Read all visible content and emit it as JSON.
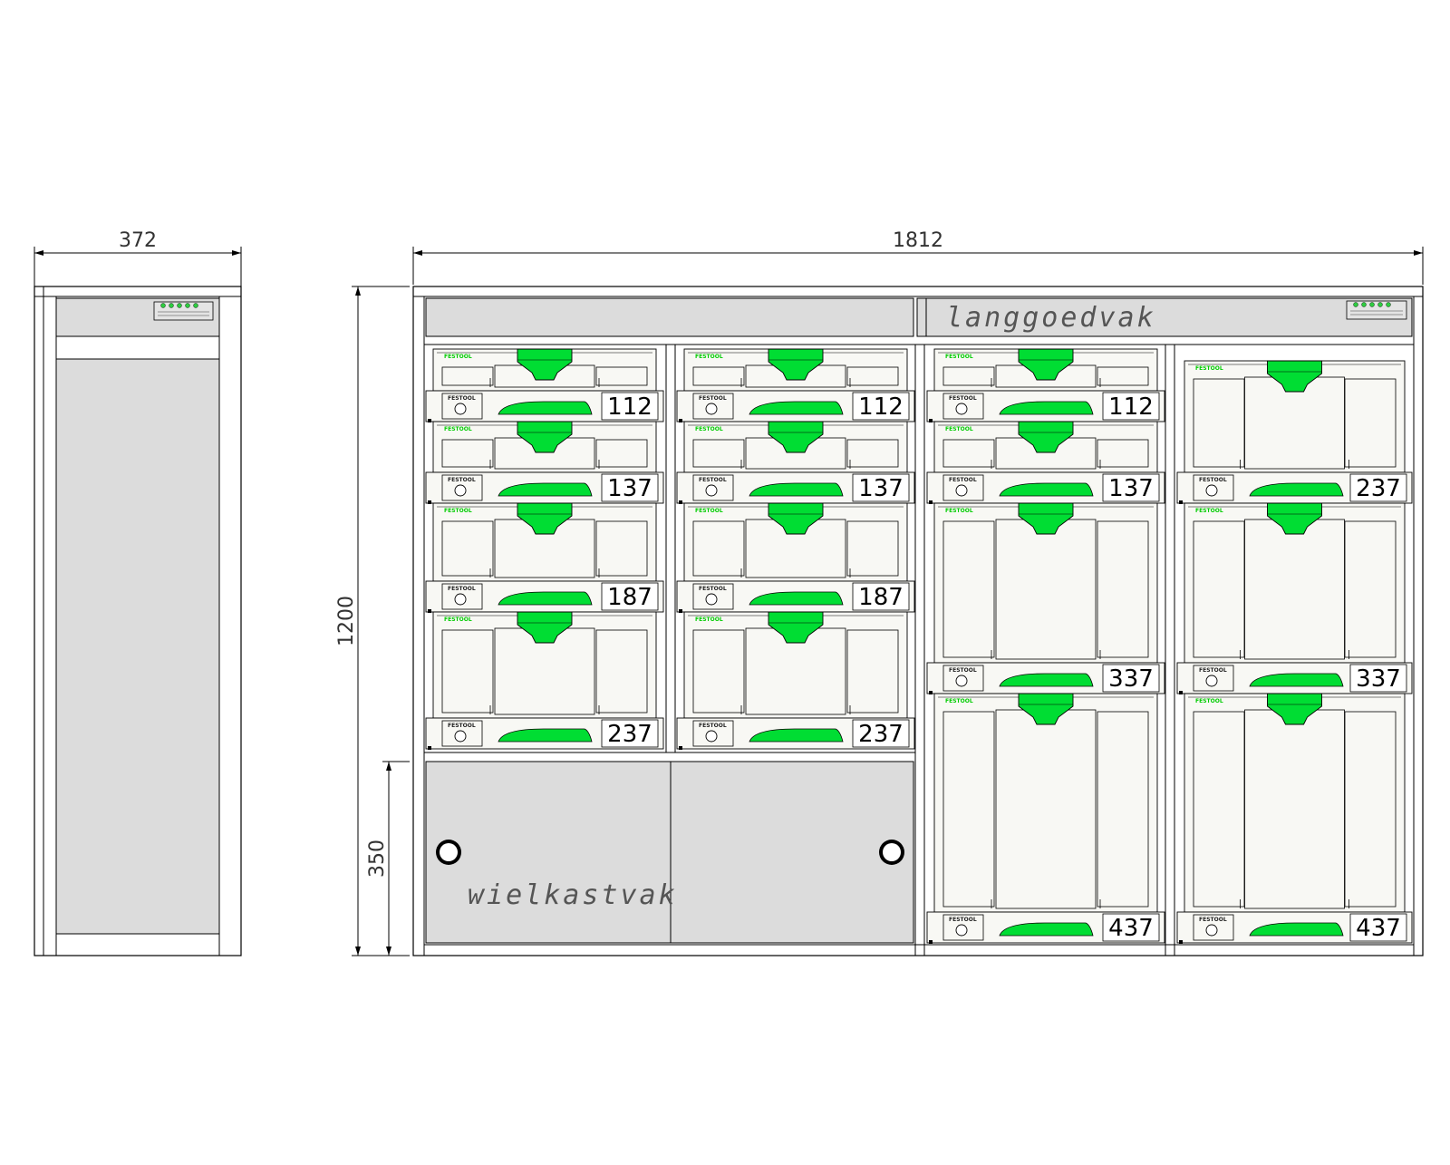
{
  "dimensions": {
    "side_width": "372",
    "total_width": "1812",
    "total_height": "1200",
    "lower_height": "350"
  },
  "labels": {
    "top_compartment": "langgoedvak",
    "wheel_compartment": "wielkastvak"
  },
  "brand_text": "FESTOOL",
  "columns": [
    {
      "systainers": [
        "112",
        "137",
        "187",
        "237"
      ]
    },
    {
      "systainers": [
        "112",
        "137",
        "187",
        "237"
      ]
    },
    {
      "systainers": [
        "112",
        "137",
        "337",
        "437"
      ]
    },
    {
      "systainers": [
        "237",
        "337",
        "437"
      ]
    }
  ],
  "colors": {
    "panel_grey": "#dcdcdc",
    "systainer_body": "#f8f8f4",
    "handle_green": "#00dd33",
    "line": "#000000"
  },
  "icons": [
    "door-knob-icon",
    "logo-plate-icon"
  ]
}
